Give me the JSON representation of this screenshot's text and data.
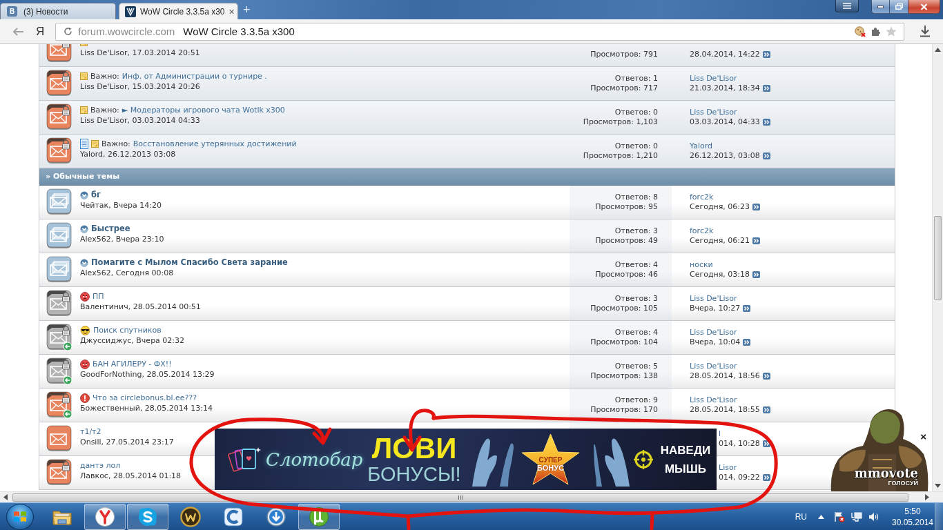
{
  "browser": {
    "tabs": [
      {
        "label": "(3) Новости",
        "favicon_letter": "В",
        "selected": false
      },
      {
        "label": "WoW Circle 3.3.5a x30",
        "close": "×",
        "selected": true
      }
    ],
    "new_tab": "+",
    "home_button": "Я",
    "address": {
      "domain": "forum.wowcircle.com",
      "title": "WoW Circle 3.3.5a x300"
    }
  },
  "forum": {
    "sections": [
      {
        "threads": [
          {
            "kind": "plain",
            "sticky": true,
            "color": "#e8845e",
            "locked": true,
            "posted": false,
            "unread": false,
            "author": "Liss De'Lisor, 17.03.2014 20:51",
            "views": "Просмотров: 791",
            "last_date": "28.04.2014, 14:22"
          },
          {
            "kind": "plain",
            "sticky": true,
            "color": "#e8845e",
            "locked": true,
            "posted": false,
            "unread": false,
            "prefix": "Важно:",
            "title": "Инф. от Администрации о турнире .",
            "author": "Liss De'Lisor, 15.03.2014 20:26",
            "replies": "Ответов: 1",
            "views": "Просмотров: 717",
            "last_user": "Liss De'Lisor",
            "last_date": "21.03.2014, 18:34"
          },
          {
            "kind": "plain",
            "sticky": true,
            "color": "#e8845e",
            "locked": true,
            "posted": false,
            "unread": false,
            "prefix": "Важно:",
            "title": "► Модераторы игрового чата Wotlk x300",
            "author": "Liss De'Lisor, 03.03.2014 04:33",
            "replies": "Ответов: 0",
            "views": "Просмотров: 1,103",
            "last_user": "Liss De'Lisor",
            "last_date": "03.03.2014, 04:33"
          },
          {
            "kind": "document",
            "sticky": true,
            "color": "#e8845e",
            "locked": true,
            "posted": false,
            "unread": false,
            "prefix": "Важно:",
            "title": "Восстановление утерянных достижений",
            "author": "Yalord, 26.12.2013 03:08",
            "replies": "Ответов: 0",
            "views": "Просмотров: 1,210",
            "last_user": "Yalord",
            "last_date": "26.12.2013, 03:08"
          }
        ]
      },
      {
        "title": "» Обычные темы",
        "threads": [
          {
            "kind": "plain",
            "sticky": false,
            "color": "#a7c3da",
            "locked": false,
            "posted": false,
            "unread": true,
            "title": "бг",
            "author": "Чейтак, Вчера 14:20",
            "replies": "Ответов: 8",
            "views": "Просмотров: 95",
            "last_user": "forc2k",
            "last_date": "Сегодня, 06:23"
          },
          {
            "kind": "plain",
            "sticky": false,
            "color": "#a7c3da",
            "locked": false,
            "posted": false,
            "unread": true,
            "title": "Быстрее",
            "author": "Alex562, Вчера 23:10",
            "replies": "Ответов: 3",
            "views": "Просмотров: 49",
            "last_user": "forc2k",
            "last_date": "Сегодня, 06:21"
          },
          {
            "kind": "plain",
            "sticky": false,
            "color": "#a7c3da",
            "locked": false,
            "posted": false,
            "unread": true,
            "title": "Помагите с Мылом Спасибо Света зарание",
            "author": "Alex562, Сегодня 00:08",
            "replies": "Ответов: 4",
            "views": "Просмотров: 46",
            "last_user": "носки",
            "last_date": "Сегодня, 03:18"
          },
          {
            "kind": "angry",
            "sticky": false,
            "color": "#b3b3b3",
            "locked": true,
            "posted": false,
            "unread": false,
            "title": "ПП",
            "author": "Валентинич, 28.05.2014 00:51",
            "replies": "Ответов: 3",
            "views": "Просмотров: 105",
            "last_user": "Liss De'Lisor",
            "last_date": "Вчера, 10:27"
          },
          {
            "kind": "cool",
            "sticky": false,
            "color": "#b3b3b3",
            "locked": true,
            "posted": true,
            "unread": false,
            "title": "Поиск спутников",
            "author": "Джуссиджус, Вчера 02:32",
            "replies": "Ответов: 4",
            "views": "Просмотров: 104",
            "last_user": "Liss De'Lisor",
            "last_date": "Вчера, 10:04"
          },
          {
            "kind": "angry",
            "sticky": false,
            "color": "#b3b3b3",
            "locked": true,
            "posted": true,
            "unread": false,
            "title": "БАН АГИЛЕРУ - ФХ!!",
            "author": "GoodForNothing, 28.05.2014 13:29",
            "replies": "Ответов: 5",
            "views": "Просмотров: 138",
            "last_user": "Liss De'Lisor",
            "last_date": "28.05.2014, 18:56"
          },
          {
            "kind": "alert",
            "sticky": false,
            "color": "#e8845e",
            "locked": true,
            "posted": true,
            "unread": false,
            "title": "Что за circlebonus.bl.ee???",
            "author": "Божественный, 28.05.2014 13:14",
            "replies": "Ответов: 9",
            "views": "Просмотров: 170",
            "last_user": "Liss De'Lisor",
            "last_date": "28.05.2014, 18:55"
          },
          {
            "kind": "plain",
            "sticky": false,
            "color": "#e8845e",
            "locked": false,
            "posted": false,
            "unread": false,
            "covered": true,
            "title": "т1/т2",
            "author": "Onsill, 27.05.2014 23:17",
            "last_user": "l",
            "last_date": "014, 10:28"
          },
          {
            "kind": "plain",
            "sticky": false,
            "color": "#e8845e",
            "locked": true,
            "posted": false,
            "unread": false,
            "covered": true,
            "title": "дантэ лол",
            "author": "Лавкос, 28.05.2014 01:18",
            "last_user": "Lisor",
            "last_date": "014, 09:22"
          }
        ]
      }
    ]
  },
  "banner": {
    "logo": "Слотобар",
    "headline": "ЛОВИ",
    "subline": "БОНУСЫ!",
    "star_top": "СУПЕР",
    "star_bottom": "БОНУС",
    "cta": "НАВЕДИ МЫШЬ"
  },
  "vote_widget": {
    "logo": "mmovote",
    "caption": "ГОЛОСУЙ",
    "close": "×"
  },
  "taskbar": {
    "apps": [
      {
        "kind": "folder",
        "running": false
      },
      {
        "kind": "y-browser",
        "running": true
      },
      {
        "kind": "messenger",
        "running": true
      },
      {
        "kind": "game",
        "running": false
      },
      {
        "kind": "c-app",
        "running": false
      },
      {
        "kind": "downloader",
        "running": false
      },
      {
        "kind": "torrent",
        "running": true
      }
    ],
    "language": "RU",
    "time": "5:50",
    "date": "30.05.2014"
  }
}
